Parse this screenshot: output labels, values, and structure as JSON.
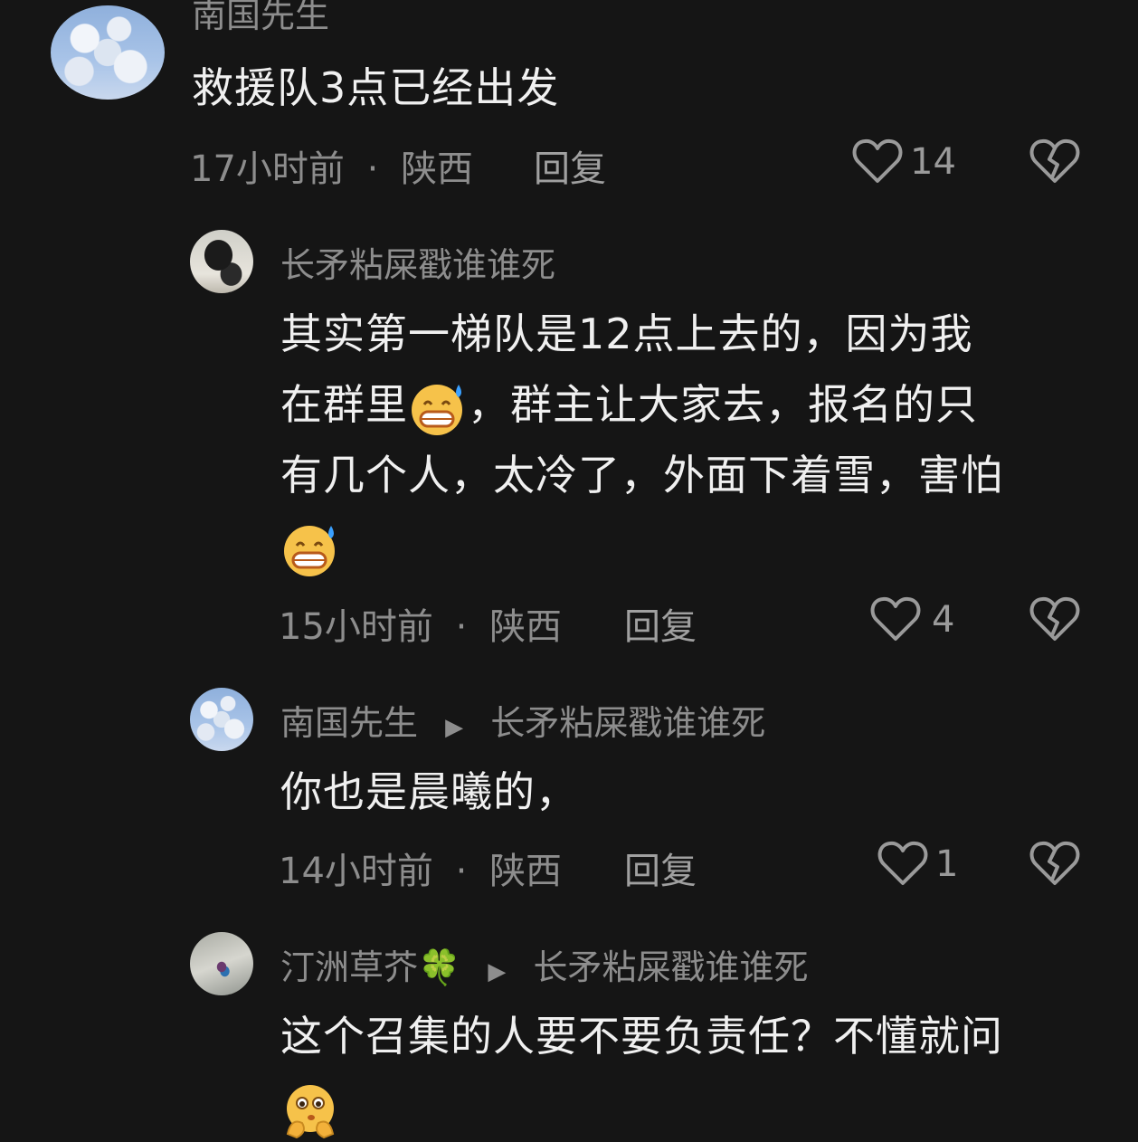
{
  "comments": [
    {
      "username": "南国先生",
      "text": "救援队3点已经出发",
      "time": "17小时前",
      "location": "陕西",
      "reply_label": "回复",
      "likes": "14"
    },
    {
      "username": "长矛粘屎戳谁谁死",
      "text_line1": "其实第一梯队是12点上去的，因为我",
      "text_line2a": "在群里",
      "text_line2b": "，群主让大家去，报名的只",
      "text_line3": "有几个人，太冷了，外面下着雪，害怕",
      "time": "15小时前",
      "location": "陕西",
      "reply_label": "回复",
      "likes": "4"
    },
    {
      "username": "南国先生",
      "reply_to": "长矛粘屎戳谁谁死",
      "text": "你也是晨曦的，",
      "time": "14小时前",
      "location": "陕西",
      "reply_label": "回复",
      "likes": "1"
    },
    {
      "username": "汀洲草芥🍀",
      "reply_to": "长矛粘屎戳谁谁死",
      "text": "这个召集的人要不要负责任？不懂就问"
    }
  ],
  "meta_separator": "·",
  "icons": [
    "heart-outline-icon",
    "broken-heart-icon",
    "grin-sweat-emoji-icon",
    "thinking-emoji-icon",
    "play-arrow-icon"
  ]
}
